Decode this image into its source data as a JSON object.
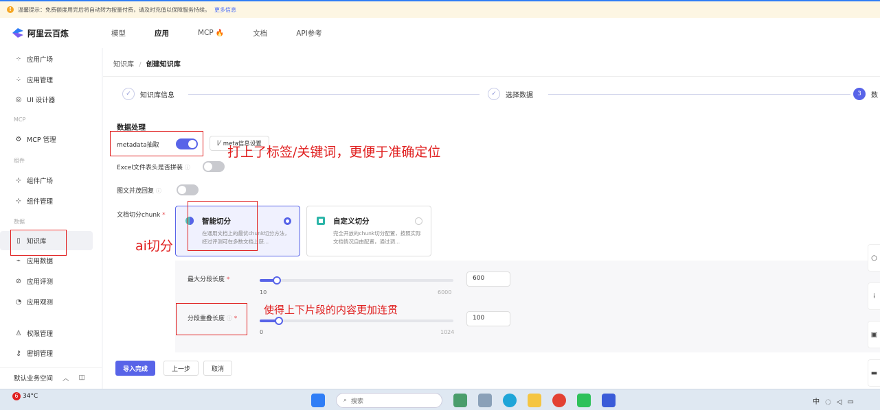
{
  "notice": {
    "text": "温馨提示：免费额度用完后将自动转为按量付费，请及时充值以保障服务持续。",
    "more": "更多信息"
  },
  "brand": {
    "name": "阿里云百炼"
  },
  "topnav": {
    "items": [
      {
        "label": "模型"
      },
      {
        "label": "应用"
      },
      {
        "label": "MCP"
      },
      {
        "label": "文档"
      },
      {
        "label": "API参考"
      }
    ],
    "active": "应用"
  },
  "sidebar": {
    "items": [
      {
        "label": "应用广场",
        "icon": "grid-icon"
      },
      {
        "label": "应用管理",
        "icon": "grid-icon"
      },
      {
        "label": "UI 设计器",
        "icon": "palette-icon"
      },
      {
        "label": "MCP 管理",
        "icon": "mcp-icon"
      },
      {
        "label": "组件广场",
        "icon": "component-icon"
      },
      {
        "label": "组件管理",
        "icon": "component-icon"
      },
      {
        "label": "知识库",
        "icon": "book-icon"
      },
      {
        "label": "应用数据",
        "icon": "chart-icon"
      },
      {
        "label": "应用评测",
        "icon": "evaluate-icon"
      },
      {
        "label": "应用观测",
        "icon": "observe-icon"
      },
      {
        "label": "权限管理",
        "icon": "user-icon"
      },
      {
        "label": "密钥管理",
        "icon": "key-icon"
      }
    ],
    "sections": [
      "MCP",
      "组件",
      "数据"
    ],
    "workspace": "默认业务空间"
  },
  "breadcrumb": {
    "parent": "知识库",
    "sep": "/",
    "current": "创建知识库"
  },
  "steps": [
    {
      "label": "知识库信息",
      "mark": "✓"
    },
    {
      "label": "选择数据",
      "mark": "✓"
    },
    {
      "label": "数",
      "mark": "3"
    }
  ],
  "form": {
    "section_title": "数据处理",
    "metadata_label": "metadata抽取",
    "metadata_on": true,
    "meta_button": "meta信息设置",
    "excel_label": "Excel文件表头是否拼装",
    "excel_on": false,
    "image_label": "图文并茂回复",
    "image_on": false,
    "chunk_label": "文档切分chunk",
    "chunk_options": [
      {
        "title": "智能切分",
        "desc": "在通用文档上的最优chunk切分方法，经过评测可在多数文档上获...",
        "selected": true
      },
      {
        "title": "自定义切分",
        "desc": "完全开放的chunk切分配置，按照实际文档情况自由配置，通过调...",
        "selected": false
      }
    ],
    "max_len": {
      "label": "最大分段长度",
      "min": "10",
      "max": "6000",
      "value": "600",
      "fraction": 0.09
    },
    "overlap": {
      "label": "分段重叠长度",
      "min": "0",
      "max": "1024",
      "value": "100",
      "fraction": 0.1
    }
  },
  "footer": {
    "done": "导入完成",
    "prev": "上一步",
    "cancel": "取消"
  },
  "annotations": {
    "metadata": "打上了标签/关键词，更便于准确定位",
    "ai": "ai切分",
    "overlap": "使得上下片段的内容更加连贯"
  },
  "taskbar": {
    "temp": "34°C",
    "badge": "6",
    "search": "搜索"
  },
  "colors": {
    "accent": "#5864e8",
    "annotation": "#e02020"
  }
}
